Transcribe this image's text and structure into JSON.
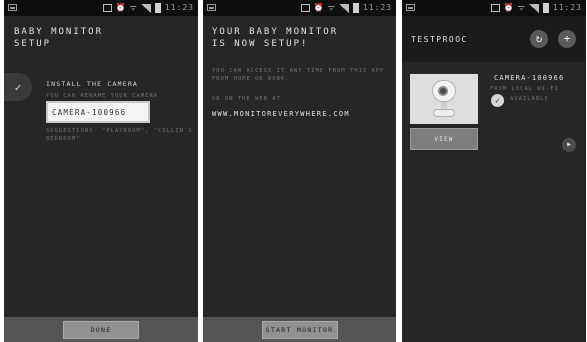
{
  "statusbar": {
    "time": "11:23",
    "icons": [
      "app-icon",
      "sim-icon",
      "alarm-icon",
      "wifi-icon",
      "signal-icon",
      "battery-icon"
    ]
  },
  "screen1": {
    "title": "BABY MONITOR\nSETUP",
    "step_label": "INSTALL THE CAMERA",
    "rename_hint": "YOU CAN RENAME YOUR CAMERA",
    "camera_name_value": "CAMERA-100966",
    "suggestions": "SUGGESTIONS: \"PLAYROOM\", \"COLLIN'S BEDROOM\"",
    "done_label": "DONE"
  },
  "screen2": {
    "title": "YOUR BABY MONITOR\nIS NOW SETUP!",
    "access_text": "YOU CAN ACCESS IT ANY TIME FROM THIS APP FROM HOME OR WORK.",
    "or_web": "OR ON THE WEB AT",
    "url": "WWW.MONITOREVERYWHERE.COM",
    "start_label": "START MONITOR"
  },
  "screen3": {
    "app_name": "TESTPROOC",
    "camera_name": "CAMERA-100966",
    "connection": "FROM LOCAL WI-FI",
    "status": "AVAILABLE",
    "view_label": "VIEW"
  },
  "colors": {
    "background": "#262626",
    "statusbar": "#0e0e0e",
    "bottombar": "#555555",
    "button": "#919191",
    "text": "#e3e3e3"
  }
}
